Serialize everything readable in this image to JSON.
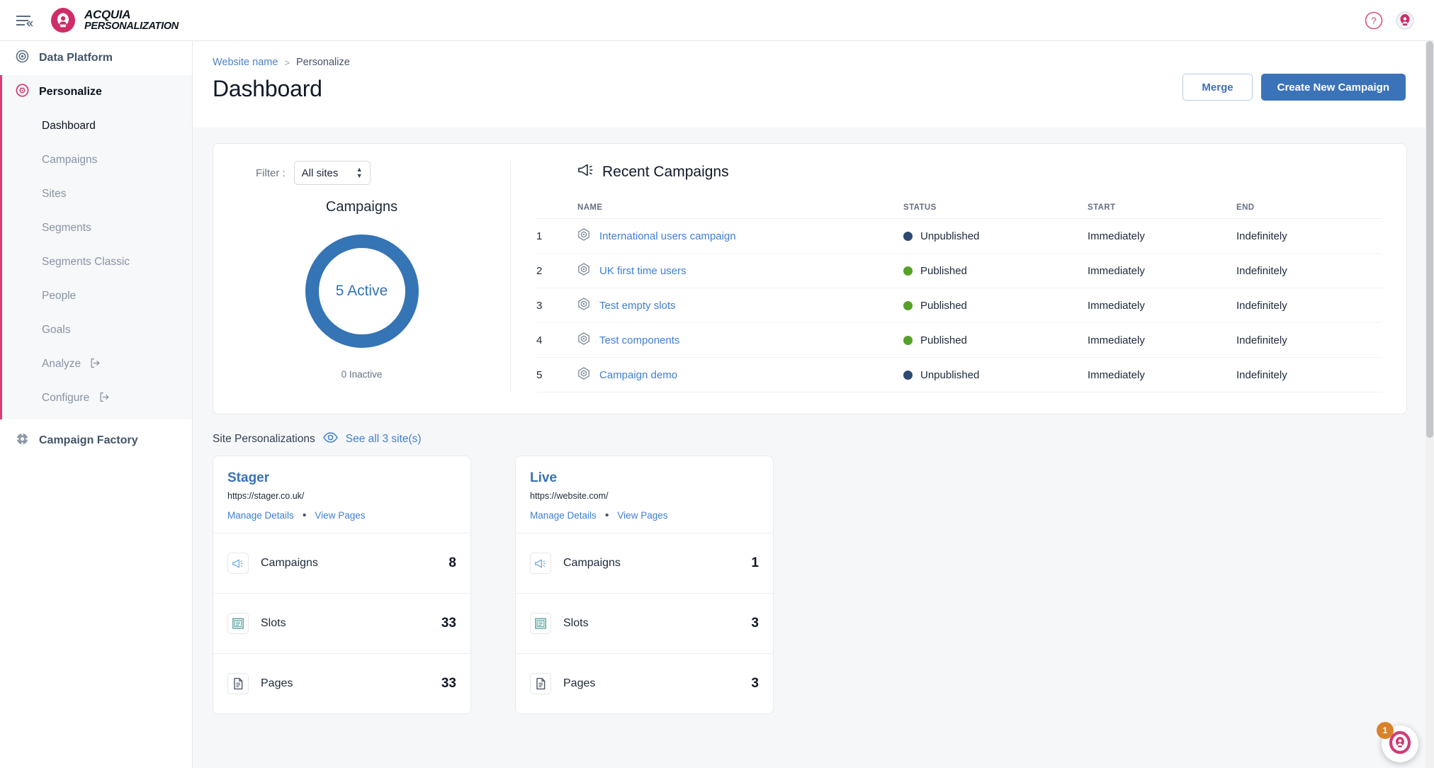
{
  "topbar": {
    "menu_icon": "hamburger-collapse-icon",
    "brand_line1": "ACQUIA",
    "brand_line2": "PERSONALIZATION",
    "help_icon": "help-circle-icon",
    "profile_icon": "user-avatar-icon"
  },
  "sidebar": {
    "data_platform": {
      "label": "Data Platform",
      "icon": "target-icon"
    },
    "personalize": {
      "label": "Personalize",
      "icon": "personalize-icon"
    },
    "sub_items": [
      {
        "label": "Dashboard",
        "active": true,
        "external": false
      },
      {
        "label": "Campaigns",
        "active": false,
        "external": false
      },
      {
        "label": "Sites",
        "active": false,
        "external": false
      },
      {
        "label": "Segments",
        "active": false,
        "external": false
      },
      {
        "label": "Segments Classic",
        "active": false,
        "external": false
      },
      {
        "label": "People",
        "active": false,
        "external": false
      },
      {
        "label": "Goals",
        "active": false,
        "external": false
      },
      {
        "label": "Analyze",
        "active": false,
        "external": true
      },
      {
        "label": "Configure",
        "active": false,
        "external": true
      }
    ],
    "campaign_factory": {
      "label": "Campaign Factory",
      "icon": "factory-icon"
    },
    "accent_color": "#dd3c73"
  },
  "header": {
    "breadcrumb": {
      "root": "Website name",
      "separator": ">",
      "current": "Personalize"
    },
    "title": "Dashboard",
    "merge_label": "Merge",
    "create_label": "Create New Campaign",
    "primary_color": "#3b73b9"
  },
  "overview": {
    "filter_label": "Filter :",
    "filter_value": "All sites",
    "filter_options": [
      "All sites"
    ],
    "chart_title": "Campaigns",
    "donut_center": "5 Active",
    "inactive_text": "0 Inactive",
    "donut_color": "#3574b5"
  },
  "recent_campaigns": {
    "title": "Recent Campaigns",
    "title_icon": "megaphone-icon",
    "columns": [
      "",
      "NAME",
      "STATUS",
      "START",
      "END"
    ],
    "rows": [
      {
        "index": "1",
        "name": "International users campaign",
        "status": "Unpublished",
        "status_color": "#2e4a73",
        "start": "Immediately",
        "end": "Indefinitely"
      },
      {
        "index": "2",
        "name": "UK first time users",
        "status": "Published",
        "status_color": "#54a227",
        "start": "Immediately",
        "end": "Indefinitely"
      },
      {
        "index": "3",
        "name": "Test empty slots",
        "status": "Published",
        "status_color": "#54a227",
        "start": "Immediately",
        "end": "Indefinitely"
      },
      {
        "index": "4",
        "name": "Test components",
        "status": "Published",
        "status_color": "#54a227",
        "start": "Immediately",
        "end": "Indefinitely"
      },
      {
        "index": "5",
        "name": "Campaign demo",
        "status": "Unpublished",
        "status_color": "#2e4a73",
        "start": "Immediately",
        "end": "Indefinitely"
      }
    ]
  },
  "site_personalizations": {
    "title": "Site Personalizations",
    "eye_icon": "eye-icon",
    "see_all_label": "See all 3 site(s)",
    "cards": [
      {
        "name": "Stager",
        "url": "https://stager.co.uk/",
        "manage_label": "Manage Details",
        "view_label": "View Pages",
        "metrics": [
          {
            "icon": "megaphone-icon",
            "label": "Campaigns",
            "value": "8"
          },
          {
            "icon": "slots-icon",
            "label": "Slots",
            "value": "33"
          },
          {
            "icon": "page-icon",
            "label": "Pages",
            "value": "33"
          }
        ]
      },
      {
        "name": "Live",
        "url": "https://website.com/",
        "manage_label": "Manage Details",
        "view_label": "View Pages",
        "metrics": [
          {
            "icon": "megaphone-icon",
            "label": "Campaigns",
            "value": "1"
          },
          {
            "icon": "slots-icon",
            "label": "Slots",
            "value": "3"
          },
          {
            "icon": "page-icon",
            "label": "Pages",
            "value": "3"
          }
        ]
      }
    ]
  },
  "help_widget": {
    "badge": "1",
    "icon": "acquia-help-icon"
  }
}
